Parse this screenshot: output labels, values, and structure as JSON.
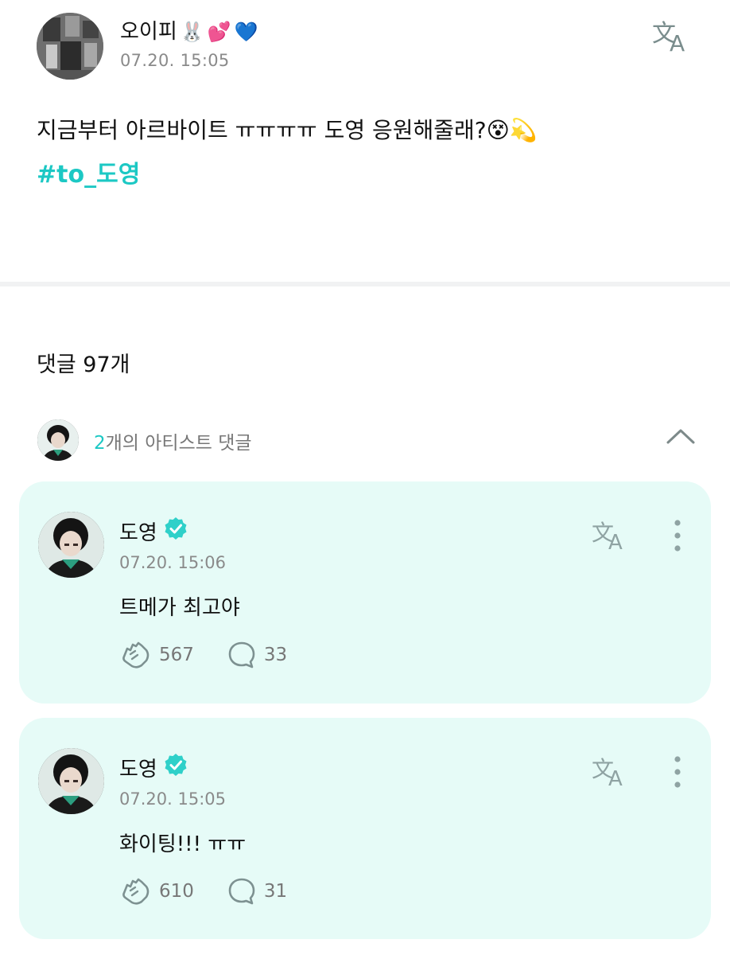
{
  "post": {
    "author": "오이피",
    "author_emojis": [
      "🐰",
      "💕",
      "💙"
    ],
    "time": "07.20. 15:05",
    "body": "지금부터 아르바이트 ㅠㅠㅠㅠ 도영 응원해줄래?",
    "body_emojis": [
      "😵",
      "💫"
    ],
    "hashtag": "#to_도영",
    "translate_icon": "translate-icon"
  },
  "comments_header": {
    "label": "댓글 97개"
  },
  "artist_comments": {
    "count_num": "2",
    "count_text": "개의 아티스트 댓글",
    "toggle_icon": "chevron-up-icon"
  },
  "comments": [
    {
      "name": "도영",
      "verified_icon": "verified-badge-icon",
      "time": "07.20. 15:06",
      "text": "트메가 최고야",
      "likes": "567",
      "replies": "33"
    },
    {
      "name": "도영",
      "verified_icon": "verified-badge-icon",
      "time": "07.20. 15:05",
      "text": "화이팅!!! ㅠㅠ",
      "likes": "610",
      "replies": "31"
    }
  ],
  "colors": {
    "accent": "#1cc8c4",
    "card_bg": "#e6fbf7",
    "muted_text": "#8a8a8a",
    "icon_grey": "#8fa3a3"
  }
}
